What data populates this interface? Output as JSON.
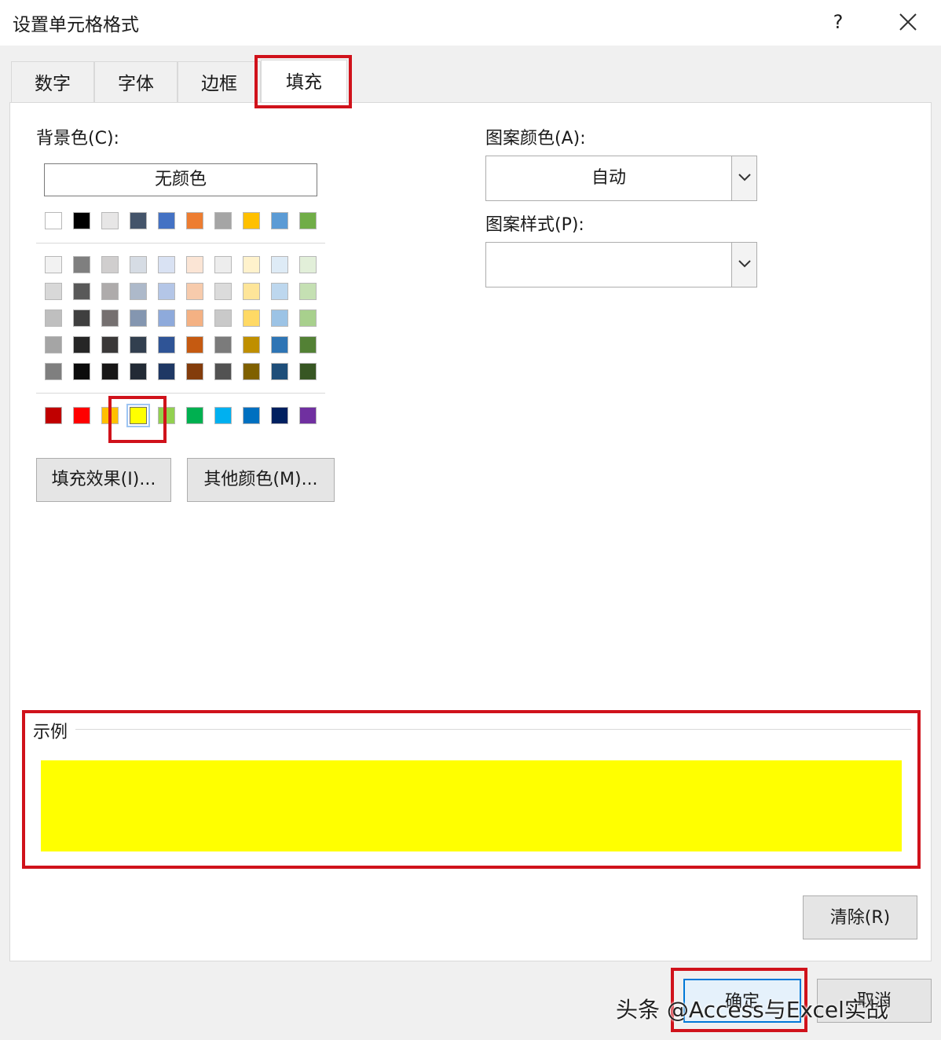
{
  "window": {
    "title": "设置单元格格式",
    "help": "?"
  },
  "tabs": [
    "数字",
    "字体",
    "边框",
    "填充"
  ],
  "active_tab": "填充",
  "fill": {
    "background_label": "背景色(C):",
    "no_color_button": "无颜色",
    "palette_theme_top": [
      "#ffffff",
      "#000000",
      "#e7e6e6",
      "#44546a",
      "#4472c4",
      "#ed7d31",
      "#a5a5a5",
      "#ffc000",
      "#5b9bd5",
      "#70ad47"
    ],
    "palette_theme_shades": [
      [
        "#f2f2f2",
        "#7f7f7f",
        "#d0cece",
        "#d6dce4",
        "#d9e2f3",
        "#fbe5d5",
        "#ededed",
        "#fff2cc",
        "#deebf6",
        "#e2efd9"
      ],
      [
        "#d8d8d8",
        "#595959",
        "#aeabab",
        "#adb9ca",
        "#b4c6e7",
        "#f7cbac",
        "#dbdbdb",
        "#fee599",
        "#bdd7ee",
        "#c5e0b3"
      ],
      [
        "#bfbfbf",
        "#3f3f3f",
        "#757070",
        "#8496b0",
        "#8eaadb",
        "#f4b183",
        "#c9c9c9",
        "#ffd965",
        "#9cc3e5",
        "#a8d08d"
      ],
      [
        "#a5a5a5",
        "#262626",
        "#3a3838",
        "#323f4f",
        "#2f5496",
        "#c55a11",
        "#7b7b7b",
        "#bf8f00",
        "#2e75b5",
        "#538135"
      ],
      [
        "#7f7f7f",
        "#0c0c0c",
        "#171616",
        "#222a35",
        "#1f3864",
        "#833c0b",
        "#525252",
        "#7f6000",
        "#1e4e79",
        "#375623"
      ]
    ],
    "palette_standard": [
      "#c00000",
      "#ff0000",
      "#ffc000",
      "#ffff00",
      "#92d050",
      "#00b050",
      "#00b0f0",
      "#0070c0",
      "#002060",
      "#7030a0"
    ],
    "selected_color": "#ffff00",
    "fill_effects_button": "填充效果(I)...",
    "more_colors_button": "其他颜色(M)...",
    "pattern_color_label": "图案颜色(A):",
    "pattern_color_value": "自动",
    "pattern_style_label": "图案样式(P):",
    "pattern_style_value": "",
    "sample_label": "示例",
    "sample_color": "#ffff00",
    "clear_button": "清除(R)"
  },
  "footer": {
    "ok_button": "确定",
    "cancel_button": "取消"
  },
  "watermark": "头条 @Access与Excel实战",
  "highlight_color": "#d0121b"
}
